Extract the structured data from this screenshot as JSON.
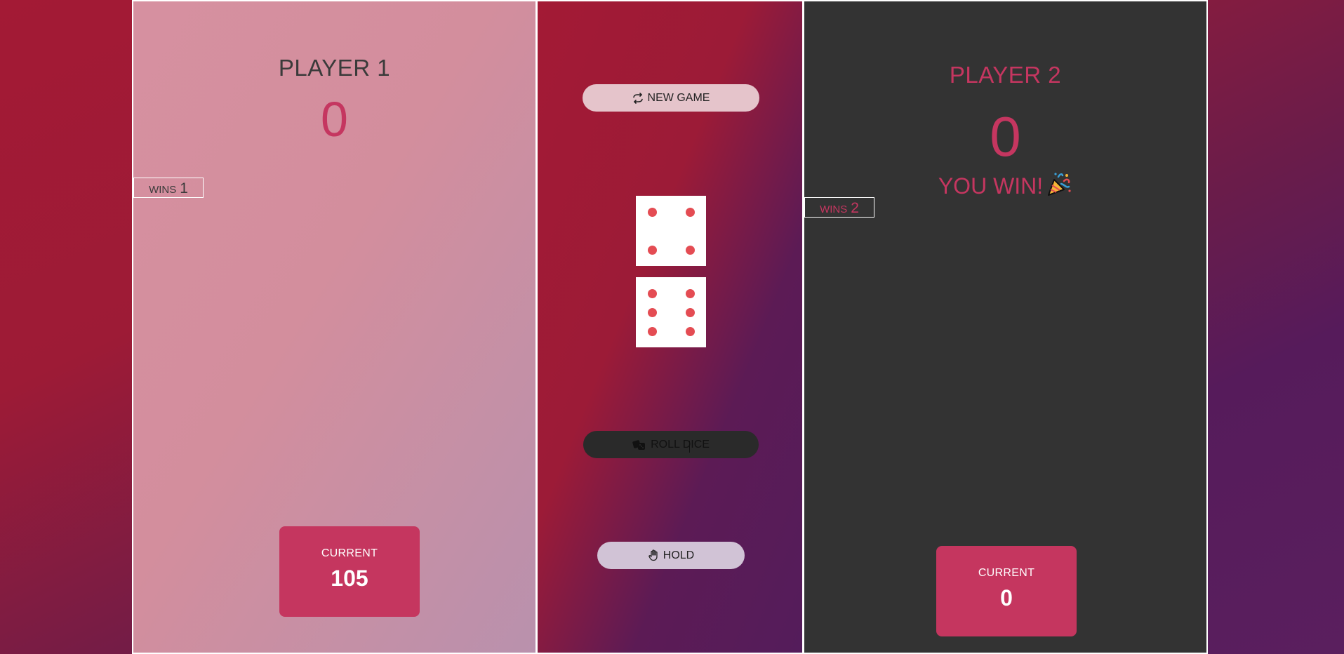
{
  "player1": {
    "name": "PLAYER 1",
    "score": "0",
    "wins_label": "WINS",
    "wins_value": "1",
    "current_label": "CURRENT",
    "current_value": "105"
  },
  "player2": {
    "name": "PLAYER 2",
    "score": "0",
    "win_message": "YOU WIN!",
    "wins_label": "WINS",
    "wins_value": "2",
    "current_label": "CURRENT",
    "current_value": "0"
  },
  "controls": {
    "new_game_label": "NEW GAME",
    "roll_dice_label": "ROLL DICE",
    "hold_label": "HOLD"
  },
  "dice": [
    {
      "value": 4
    },
    {
      "value": 6
    }
  ],
  "icons": {
    "new_game": "refresh-icon",
    "roll_dice": "dice-icon",
    "hold": "hand-icon",
    "win": "party-popper-icon"
  },
  "colors": {
    "accent": "#c5365f",
    "pip": "#e44c53",
    "panel_dark": "#333333"
  }
}
